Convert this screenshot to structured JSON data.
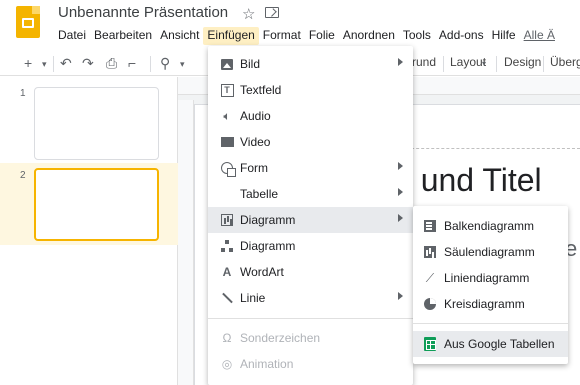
{
  "app": {
    "title": "Unbenannte Präsentation"
  },
  "menubar": [
    "Datei",
    "Bearbeiten",
    "Ansicht",
    "Einfügen",
    "Format",
    "Folie",
    "Anordnen",
    "Tools",
    "Add-ons",
    "Hilfe",
    "Alle Ä"
  ],
  "toolbar": {
    "hintergrund_partial": "rund",
    "layout": "Layout",
    "design": "Design",
    "uebergang_partial": "Übergä"
  },
  "slides": [
    {
      "num": "1"
    },
    {
      "num": "2"
    }
  ],
  "canvas": {
    "title_partial": "n und Titel",
    "sub_partial": "e"
  },
  "insert_menu": {
    "items": [
      {
        "label": "Bild",
        "icon": "image-icon",
        "submenu": true
      },
      {
        "label": "Textfeld",
        "icon": "textbox-icon",
        "submenu": false
      },
      {
        "label": "Audio",
        "icon": "audio-icon",
        "submenu": false
      },
      {
        "label": "Video",
        "icon": "video-icon",
        "submenu": false
      },
      {
        "label": "Form",
        "icon": "shape-icon",
        "submenu": true
      },
      {
        "label": "Tabelle",
        "icon": "",
        "submenu": true
      },
      {
        "label": "Diagramm",
        "icon": "chart-icon",
        "submenu": true
      },
      {
        "label": "Diagramm",
        "icon": "diagram-icon",
        "submenu": false
      },
      {
        "label": "WordArt",
        "icon": "wordart-icon",
        "submenu": false
      },
      {
        "label": "Linie",
        "icon": "line-icon",
        "submenu": true
      },
      {
        "label": "Sonderzeichen",
        "icon": "omega-icon",
        "submenu": false
      },
      {
        "label": "Animation",
        "icon": "animation-icon",
        "submenu": false
      }
    ]
  },
  "chart_submenu": {
    "items": [
      {
        "label": "Balkendiagramm",
        "icon": "bar-chart-icon"
      },
      {
        "label": "Säulendiagramm",
        "icon": "column-chart-icon"
      },
      {
        "label": "Liniendiagramm",
        "icon": "line-chart-icon"
      },
      {
        "label": "Kreisdiagramm",
        "icon": "pie-chart-icon"
      },
      {
        "label": "Aus Google Tabellen",
        "icon": "google-sheets-icon"
      }
    ]
  },
  "colors": {
    "accent": "#f4b400",
    "selected_bg": "#fef7e0",
    "menu_highlight": "#e8eaed",
    "sheets_green": "#0f9d58"
  }
}
